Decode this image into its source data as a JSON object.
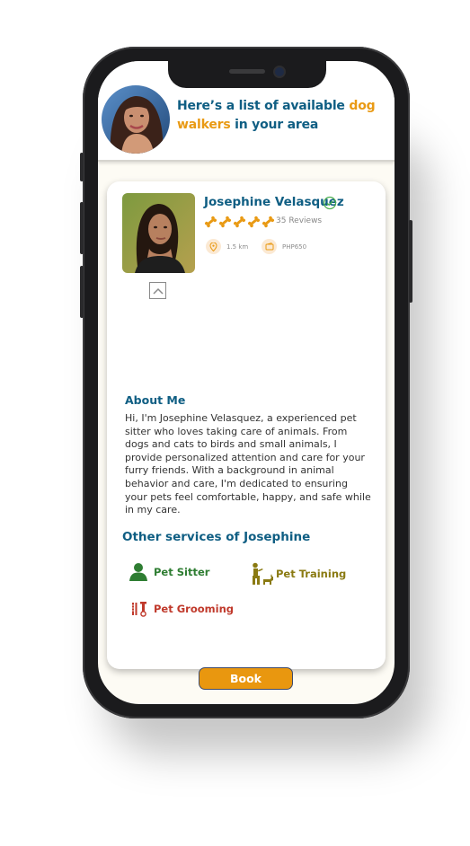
{
  "header": {
    "title_prefix": "Here’s a list of available ",
    "title_accent": "dog walkers",
    "title_suffix": " in your area"
  },
  "profile": {
    "name": "Josephine Velasquez",
    "rating": 5,
    "reviews": "35 Reviews",
    "distance": "1.5 km",
    "price": "PHP650"
  },
  "about": {
    "title": "About Me",
    "text": "Hi, I'm Josephine Velasquez, a experienced pet sitter who loves taking care of animals. From dogs and cats to birds and small animals, I provide personalized attention and care for your furry friends. With a background in animal behavior and care, I'm dedicated to ensuring your pets feel comfortable, happy, and safe while in my care."
  },
  "services": {
    "title": "Other services of Josephine",
    "items": [
      {
        "label": "Pet Sitter",
        "icon": "person-icon",
        "color": "#2e7d32"
      },
      {
        "label": "Pet Training",
        "icon": "dog-training-icon",
        "color": "#8a7a12"
      },
      {
        "label": "Pet Grooming",
        "icon": "grooming-icon",
        "color": "#c0392b"
      }
    ]
  },
  "actions": {
    "book_label": "Book"
  },
  "colors": {
    "primary": "#0f5e83",
    "accent": "#e99a14",
    "background": "#fdfbf4"
  }
}
